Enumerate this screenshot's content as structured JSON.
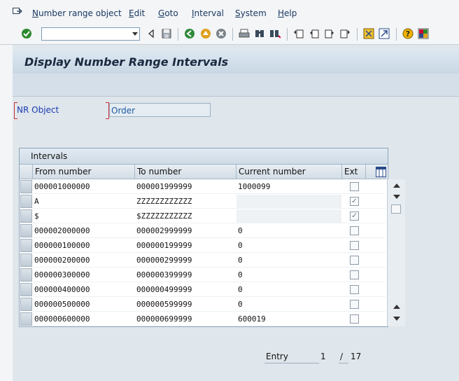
{
  "menubar": {
    "items": [
      {
        "label": "Number range object",
        "accel": "N"
      },
      {
        "label": "Edit",
        "accel": "E"
      },
      {
        "label": "Goto",
        "accel": "G"
      },
      {
        "label": "Interval",
        "accel": "I"
      },
      {
        "label": "System",
        "accel": "S"
      },
      {
        "label": "Help",
        "accel": "H"
      }
    ]
  },
  "toolbar": {
    "command_field_value": "",
    "icons": [
      "enter-icon",
      "back-icon",
      "save-icon",
      "back-green-icon",
      "exit-icon",
      "cancel-icon",
      "print-icon",
      "find-icon",
      "find-next-icon",
      "first-page-icon",
      "prev-page-icon",
      "next-page-icon",
      "last-page-icon",
      "new-session-icon",
      "shortcut-icon",
      "help-icon",
      "layout-icon"
    ]
  },
  "page": {
    "title": "Display Number Range Intervals"
  },
  "form": {
    "nr_object_label": "NR Object",
    "nr_object_value": "Order"
  },
  "table": {
    "title": "Intervals",
    "columns": [
      "From number",
      "To number",
      "Current number",
      "Ext"
    ],
    "rows": [
      {
        "from": "000001000000",
        "to": "000001999999",
        "current": "1000099",
        "ext": false,
        "current_disabled": false
      },
      {
        "from": "A",
        "to": "ZZZZZZZZZZZZ",
        "current": "",
        "ext": true,
        "current_disabled": true
      },
      {
        "from": "$",
        "to": "$ZZZZZZZZZZZ",
        "current": "",
        "ext": true,
        "current_disabled": true
      },
      {
        "from": "000002000000",
        "to": "000002999999",
        "current": "0",
        "ext": false,
        "current_disabled": false
      },
      {
        "from": "000000100000",
        "to": "000000199999",
        "current": "0",
        "ext": false,
        "current_disabled": false
      },
      {
        "from": "000000200000",
        "to": "000000299999",
        "current": "0",
        "ext": false,
        "current_disabled": false
      },
      {
        "from": "000000300000",
        "to": "000000399999",
        "current": "0",
        "ext": false,
        "current_disabled": false
      },
      {
        "from": "000000400000",
        "to": "000000499999",
        "current": "0",
        "ext": false,
        "current_disabled": false
      },
      {
        "from": "000000500000",
        "to": "000000599999",
        "current": "0",
        "ext": false,
        "current_disabled": false
      },
      {
        "from": "000000600000",
        "to": "000000699999",
        "current": "600019",
        "ext": false,
        "current_disabled": false
      }
    ]
  },
  "footer": {
    "entry_label": "Entry",
    "entry_value": "1",
    "separator": "/",
    "total": "17"
  }
}
